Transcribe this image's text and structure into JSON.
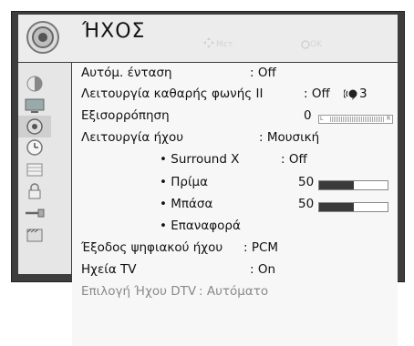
{
  "header": {
    "title": "ΉΧΟΣ",
    "move_hint": "Μετ.",
    "ok_hint": "OK"
  },
  "sidebar": {
    "icons": [
      "picture-adjust-icon",
      "monitor-icon",
      "sound-icon",
      "clock-icon",
      "option-icon",
      "lock-icon",
      "input-icon",
      "media-icon"
    ],
    "active_index": 2
  },
  "menu": {
    "auto_volume": {
      "label": "Αυτόμ. ένταση",
      "value": ": Off"
    },
    "clear_voice": {
      "label": "Λειτουργία καθαρής φωνής II",
      "value": ": Off",
      "level": "3"
    },
    "balance": {
      "label": "Εξισορρόπηση",
      "value": "0",
      "left_mark": "L",
      "right_mark": "R"
    },
    "sound_mode": {
      "label": "Λειτουργία ήχου",
      "value": ": Μουσική"
    },
    "surround": {
      "label": "• Surround X",
      "value": ": Off"
    },
    "treble": {
      "label": "• Πρίμα",
      "value": "50",
      "level_percent": 50
    },
    "bass": {
      "label": "• Μπάσα",
      "value": "50",
      "level_percent": 50
    },
    "reset": {
      "label": "• Επαναφορά"
    },
    "digital_out": {
      "label": "Έξοδος ψηφιακού ήχου",
      "value": ": PCM"
    },
    "tv_speaker": {
      "label": "Ηχεία TV",
      "value": ": On"
    },
    "dtv_audio": {
      "label": "Επιλογή Ήχου DTV",
      "value": ": Αυτόματο"
    }
  }
}
